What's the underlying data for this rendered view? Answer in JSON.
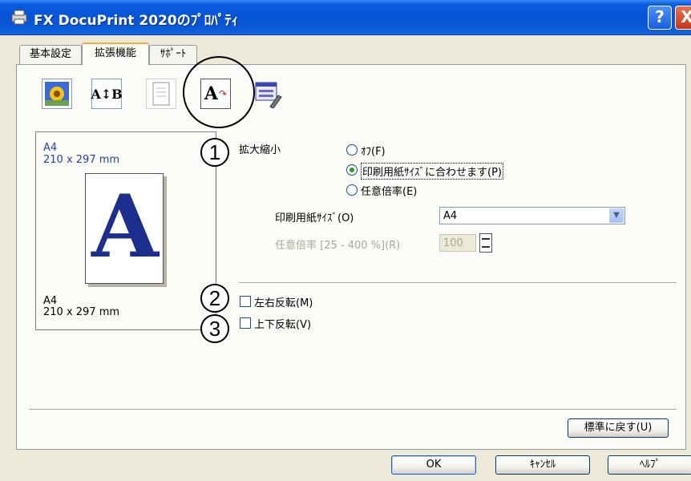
{
  "window": {
    "title": "FX DocuPrint 2020のﾌﾟﾛﾊﾟﾃｨ",
    "help_button": "?",
    "close_button": "X"
  },
  "tabs": [
    {
      "label": "基本設定",
      "selected": false
    },
    {
      "label": "拡張機能",
      "selected": true
    },
    {
      "label": "ｻﾎﾟｰﾄ",
      "selected": false
    }
  ],
  "toolbar": {
    "icons": [
      "watermark-icon",
      "ab-layout-icon",
      "copy-icon",
      "scaling-icon",
      "settings-icon"
    ],
    "ab_label": "A↕B",
    "scale_label": "A"
  },
  "preview": {
    "top_size": "A4",
    "top_dims": "210 x 297 mm",
    "bottom_size": "A4",
    "bottom_dims": "210 x 297 mm",
    "letter": "A"
  },
  "badges": [
    "1",
    "2",
    "3"
  ],
  "scaling": {
    "label": "拡大縮小",
    "options": [
      {
        "label": "ｵﾌ(F)",
        "checked": false
      },
      {
        "label": "印刷用紙ｻｲｽﾞに合わせます(P)",
        "checked": true
      },
      {
        "label": "任意倍率(E)",
        "checked": false
      }
    ],
    "paper_size_label": "印刷用紙ｻｲｽﾞ(O)",
    "paper_size_value": "A4",
    "scale_label": "任意倍率 [25 - 400 %](R)",
    "scale_value": "100"
  },
  "mirror": {
    "label": "左右反転(M)",
    "checked": false
  },
  "flip": {
    "label": "上下反転(V)",
    "checked": false
  },
  "buttons": {
    "restore": "標準に戻す(U)",
    "ok": "OK",
    "cancel": "ｷｬﾝｾﾙ",
    "help": "ﾍﾙﾌﾟ"
  },
  "colors": {
    "titlebar": "#0653d6",
    "preview_text": "#2a3e9e",
    "radio_dot": "#21a121"
  }
}
